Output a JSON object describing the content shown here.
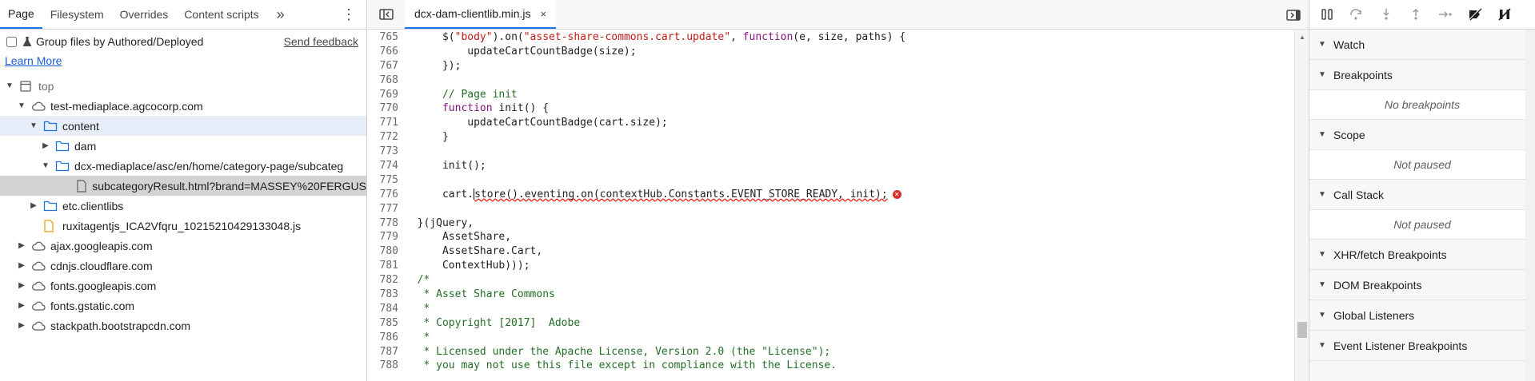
{
  "navigator": {
    "tabs": [
      "Page",
      "Filesystem",
      "Overrides",
      "Content scripts"
    ],
    "more_label": "»",
    "menu_label": "⋮",
    "group_label": "Group files by Authored/Deployed",
    "feedback": "Send feedback",
    "learn_more": "Learn More",
    "tree": [
      {
        "label": "top",
        "depth": 0,
        "arrow": "down",
        "icon": "frame-icon",
        "muted": true
      },
      {
        "label": "test-mediaplace.agcocorp.com",
        "depth": 1,
        "arrow": "down",
        "icon": "cloud-icon"
      },
      {
        "label": "content",
        "depth": 2,
        "arrow": "down",
        "icon": "folder-icon",
        "highlight": true
      },
      {
        "label": "dam",
        "depth": 3,
        "arrow": "right",
        "icon": "folder-icon"
      },
      {
        "label": "dcx-mediaplace/asc/en/home/category-page/subcateg",
        "depth": 3,
        "arrow": "down",
        "icon": "folder-icon"
      },
      {
        "label": "subcategoryResult.html?brand=MASSEY%20FERGUS",
        "depth": 5,
        "arrow": "none",
        "icon": "file-icon",
        "selected": true
      },
      {
        "label": "etc.clientlibs",
        "depth": 2,
        "arrow": "right",
        "icon": "folder-icon"
      },
      {
        "label": "ruxitagentjs_ICA2Vfqru_10215210429133048.js",
        "depth": 2,
        "arrow": "none",
        "icon": "script-file-icon"
      },
      {
        "label": "ajax.googleapis.com",
        "depth": 1,
        "arrow": "right",
        "icon": "cloud-icon"
      },
      {
        "label": "cdnjs.cloudflare.com",
        "depth": 1,
        "arrow": "right",
        "icon": "cloud-icon"
      },
      {
        "label": "fonts.googleapis.com",
        "depth": 1,
        "arrow": "right",
        "icon": "cloud-icon"
      },
      {
        "label": "fonts.gstatic.com",
        "depth": 1,
        "arrow": "right",
        "icon": "cloud-icon"
      },
      {
        "label": "stackpath.bootstrapcdn.com",
        "depth": 1,
        "arrow": "right",
        "icon": "cloud-icon"
      }
    ]
  },
  "editor": {
    "tab_title": "dcx-dam-clientlib.min.js",
    "close_glyph": "×",
    "lines": [
      {
        "n": "765",
        "parts": [
          [
            "",
            "    $("
          ],
          [
            "str",
            "\"body\""
          ],
          [
            "",
            ").on("
          ],
          [
            "str",
            "\"asset-share-commons.cart.update\""
          ],
          [
            "",
            ", "
          ],
          [
            "kw",
            "function"
          ],
          [
            "",
            "(e, size, paths) {"
          ]
        ]
      },
      {
        "n": "766",
        "parts": [
          [
            "",
            "        updateCartCountBadge(size);"
          ]
        ]
      },
      {
        "n": "767",
        "parts": [
          [
            "",
            "    });"
          ]
        ]
      },
      {
        "n": "768",
        "parts": [
          [
            "",
            ""
          ]
        ]
      },
      {
        "n": "769",
        "parts": [
          [
            "com",
            "    // Page init"
          ]
        ]
      },
      {
        "n": "770",
        "parts": [
          [
            "",
            "    "
          ],
          [
            "kw",
            "function"
          ],
          [
            "",
            " init() {"
          ]
        ]
      },
      {
        "n": "771",
        "parts": [
          [
            "",
            "        updateCartCountBadge(cart.size);"
          ]
        ]
      },
      {
        "n": "772",
        "parts": [
          [
            "",
            "    }"
          ]
        ]
      },
      {
        "n": "773",
        "parts": [
          [
            "",
            ""
          ]
        ]
      },
      {
        "n": "774",
        "parts": [
          [
            "",
            "    init();"
          ]
        ]
      },
      {
        "n": "775",
        "parts": [
          [
            "",
            ""
          ]
        ]
      },
      {
        "n": "776",
        "parts": [
          [
            "",
            "    cart."
          ],
          [
            "caret",
            ""
          ],
          [
            "squig",
            "store().eventing.on(contextHub.Constants.EVENT_STORE_READY, init);"
          ],
          [
            "err",
            "✕"
          ]
        ]
      },
      {
        "n": "777",
        "parts": [
          [
            "",
            ""
          ]
        ]
      },
      {
        "n": "778",
        "parts": [
          [
            "",
            "}(jQuery,"
          ]
        ]
      },
      {
        "n": "779",
        "parts": [
          [
            "",
            "    AssetShare,"
          ]
        ]
      },
      {
        "n": "780",
        "parts": [
          [
            "",
            "    AssetShare.Cart,"
          ]
        ]
      },
      {
        "n": "781",
        "parts": [
          [
            "",
            "    ContextHub)));"
          ]
        ]
      },
      {
        "n": "782",
        "parts": [
          [
            "com",
            "/*"
          ]
        ]
      },
      {
        "n": "783",
        "parts": [
          [
            "com",
            " * Asset Share Commons"
          ]
        ]
      },
      {
        "n": "784",
        "parts": [
          [
            "com",
            " *"
          ]
        ]
      },
      {
        "n": "785",
        "parts": [
          [
            "com",
            " * Copyright [2017]  Adobe"
          ]
        ]
      },
      {
        "n": "786",
        "parts": [
          [
            "com",
            " *"
          ]
        ]
      },
      {
        "n": "787",
        "parts": [
          [
            "com",
            " * Licensed under the Apache License, Version 2.0 (the \"License\");"
          ]
        ]
      },
      {
        "n": "788",
        "parts": [
          [
            "com",
            " * you may not use this file except in compliance with the License."
          ]
        ]
      }
    ]
  },
  "debugger": {
    "sections": [
      {
        "title": "Watch",
        "body": ""
      },
      {
        "title": "Breakpoints",
        "body": "No breakpoints"
      },
      {
        "title": "Scope",
        "body": "Not paused"
      },
      {
        "title": "Call Stack",
        "body": "Not paused"
      },
      {
        "title": "XHR/fetch Breakpoints",
        "body": ""
      },
      {
        "title": "DOM Breakpoints",
        "body": ""
      },
      {
        "title": "Global Listeners",
        "body": ""
      },
      {
        "title": "Event Listener Breakpoints",
        "body": ""
      }
    ]
  },
  "colors": {
    "accent": "#1a73e8",
    "keyword": "#881280",
    "string": "#c41a16",
    "comment": "#236e25",
    "error": "#d93025"
  }
}
